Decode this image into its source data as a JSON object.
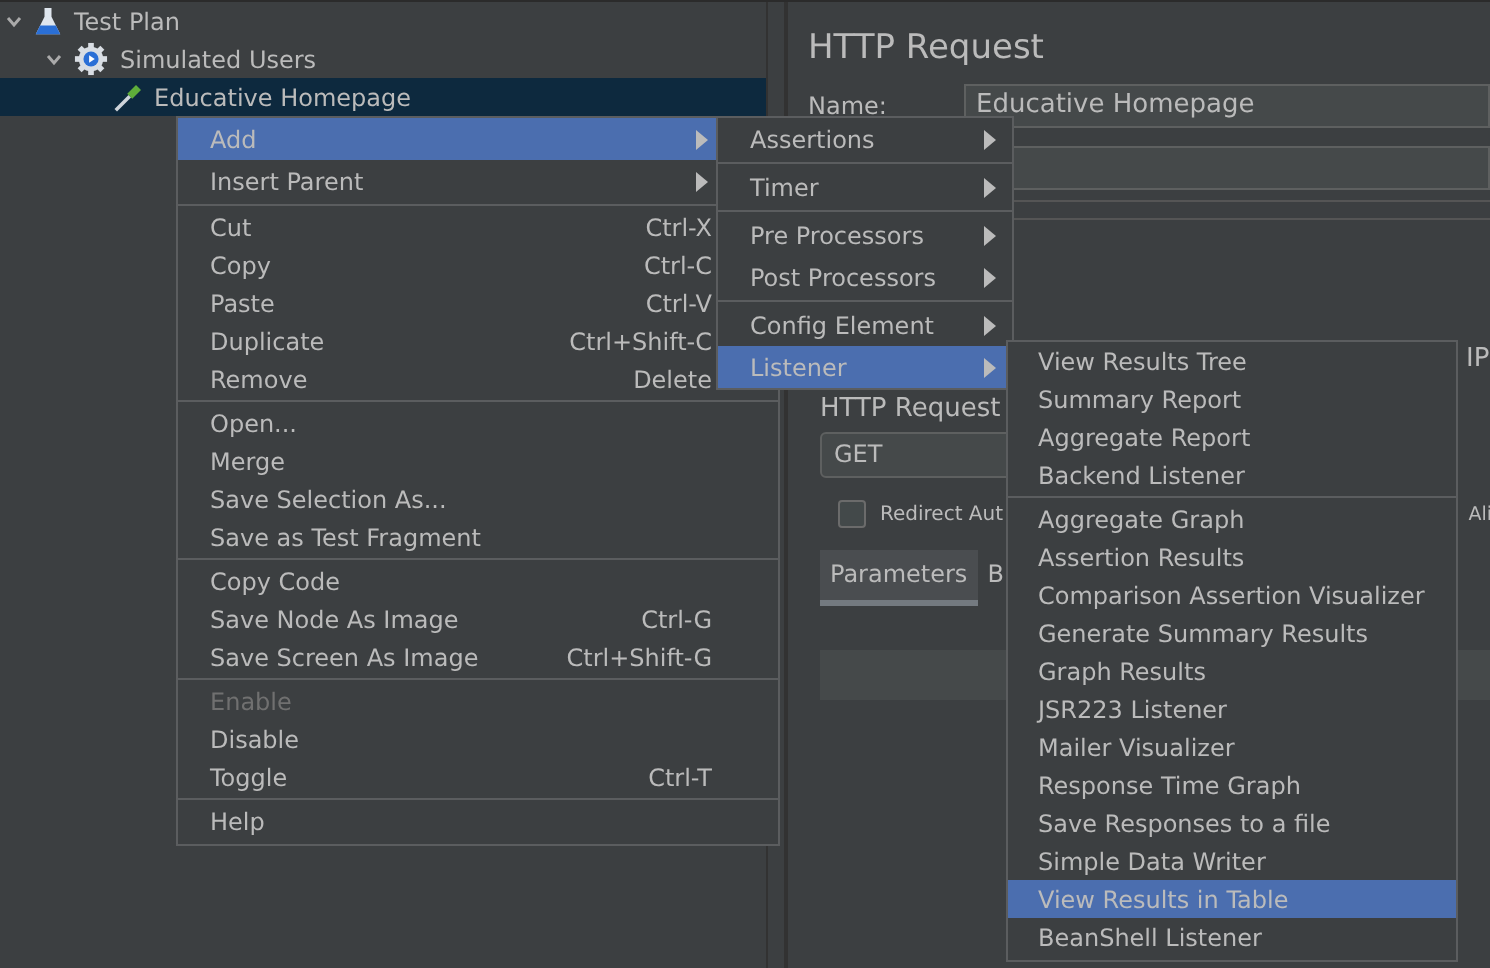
{
  "tree": [
    {
      "label": "Test Plan",
      "kind": "plan",
      "expanded": true,
      "selected": false,
      "children": [
        {
          "label": "Simulated Users",
          "kind": "thread_group",
          "expanded": true,
          "selected": false,
          "children": [
            {
              "label": "Educative Homepage",
              "kind": "sampler",
              "selected": true
            }
          ]
        }
      ]
    }
  ],
  "editor": {
    "title": "HTTP Request",
    "name_label": "Name:",
    "name_value": "Educative Homepage",
    "ip_label": "IP",
    "request_group": "HTTP Request",
    "method": "GET",
    "redirect_checkbox": {
      "label": "Redirect Aut",
      "checked": false
    },
    "keepalive_fragment": "Ali",
    "tabs": [
      {
        "label": "Parameters",
        "selected": true
      },
      {
        "label": "B",
        "selected": false
      }
    ]
  },
  "context_menu": {
    "items": [
      {
        "kind": "item",
        "label": "Add",
        "submenu": true,
        "selected": true,
        "disabled": false
      },
      {
        "kind": "item",
        "label": "Insert Parent",
        "submenu": true,
        "selected": false,
        "disabled": false
      },
      {
        "kind": "separator"
      },
      {
        "kind": "item",
        "label": "Cut",
        "shortcut": "Ctrl-X",
        "submenu": false,
        "selected": false,
        "disabled": false
      },
      {
        "kind": "item",
        "label": "Copy",
        "shortcut": "Ctrl-C",
        "submenu": false,
        "selected": false,
        "disabled": false
      },
      {
        "kind": "item",
        "label": "Paste",
        "shortcut": "Ctrl-V",
        "submenu": false,
        "selected": false,
        "disabled": false
      },
      {
        "kind": "item",
        "label": "Duplicate",
        "shortcut": "Ctrl+Shift-C",
        "submenu": false,
        "selected": false,
        "disabled": false
      },
      {
        "kind": "item",
        "label": "Remove",
        "shortcut": "Delete",
        "submenu": false,
        "selected": false,
        "disabled": false
      },
      {
        "kind": "separator"
      },
      {
        "kind": "item",
        "label": "Open...",
        "submenu": false,
        "selected": false,
        "disabled": false
      },
      {
        "kind": "item",
        "label": "Merge",
        "submenu": false,
        "selected": false,
        "disabled": false
      },
      {
        "kind": "item",
        "label": "Save Selection As...",
        "submenu": false,
        "selected": false,
        "disabled": false
      },
      {
        "kind": "item",
        "label": "Save as Test Fragment",
        "submenu": false,
        "selected": false,
        "disabled": false
      },
      {
        "kind": "separator"
      },
      {
        "kind": "item",
        "label": "Copy Code",
        "submenu": false,
        "selected": false,
        "disabled": false
      },
      {
        "kind": "item",
        "label": "Save Node As Image",
        "shortcut": "Ctrl-G",
        "submenu": false,
        "selected": false,
        "disabled": false
      },
      {
        "kind": "item",
        "label": "Save Screen As Image",
        "shortcut": "Ctrl+Shift-G",
        "submenu": false,
        "selected": false,
        "disabled": false
      },
      {
        "kind": "separator"
      },
      {
        "kind": "item",
        "label": "Enable",
        "submenu": false,
        "selected": false,
        "disabled": true
      },
      {
        "kind": "item",
        "label": "Disable",
        "submenu": false,
        "selected": false,
        "disabled": false
      },
      {
        "kind": "item",
        "label": "Toggle",
        "shortcut": "Ctrl-T",
        "submenu": false,
        "selected": false,
        "disabled": false
      },
      {
        "kind": "separator"
      },
      {
        "kind": "item",
        "label": "Help",
        "submenu": false,
        "selected": false,
        "disabled": false
      }
    ]
  },
  "add_menu": {
    "items": [
      {
        "kind": "item",
        "label": "Assertions",
        "submenu": true,
        "selected": false
      },
      {
        "kind": "separator"
      },
      {
        "kind": "item",
        "label": "Timer",
        "submenu": true,
        "selected": false
      },
      {
        "kind": "separator"
      },
      {
        "kind": "item",
        "label": "Pre Processors",
        "submenu": true,
        "selected": false
      },
      {
        "kind": "item",
        "label": "Post Processors",
        "submenu": true,
        "selected": false
      },
      {
        "kind": "separator"
      },
      {
        "kind": "item",
        "label": "Config Element",
        "submenu": true,
        "selected": false
      },
      {
        "kind": "item",
        "label": "Listener",
        "submenu": true,
        "selected": true
      }
    ]
  },
  "listener_menu": {
    "items": [
      {
        "kind": "item",
        "label": "View Results Tree",
        "selected": false
      },
      {
        "kind": "item",
        "label": "Summary Report",
        "selected": false
      },
      {
        "kind": "item",
        "label": "Aggregate Report",
        "selected": false
      },
      {
        "kind": "item",
        "label": "Backend Listener",
        "selected": false
      },
      {
        "kind": "separator"
      },
      {
        "kind": "item",
        "label": "Aggregate Graph",
        "selected": false
      },
      {
        "kind": "item",
        "label": "Assertion Results",
        "selected": false
      },
      {
        "kind": "item",
        "label": "Comparison Assertion Visualizer",
        "selected": false
      },
      {
        "kind": "item",
        "label": "Generate Summary Results",
        "selected": false
      },
      {
        "kind": "item",
        "label": "Graph Results",
        "selected": false
      },
      {
        "kind": "item",
        "label": "JSR223 Listener",
        "selected": false
      },
      {
        "kind": "item",
        "label": "Mailer Visualizer",
        "selected": false
      },
      {
        "kind": "item",
        "label": "Response Time Graph",
        "selected": false
      },
      {
        "kind": "item",
        "label": "Save Responses to a file",
        "selected": false
      },
      {
        "kind": "item",
        "label": "Simple Data Writer",
        "selected": false
      },
      {
        "kind": "item",
        "label": "View Results in Table",
        "selected": true
      },
      {
        "kind": "item",
        "label": "BeanShell Listener",
        "selected": false
      }
    ]
  }
}
